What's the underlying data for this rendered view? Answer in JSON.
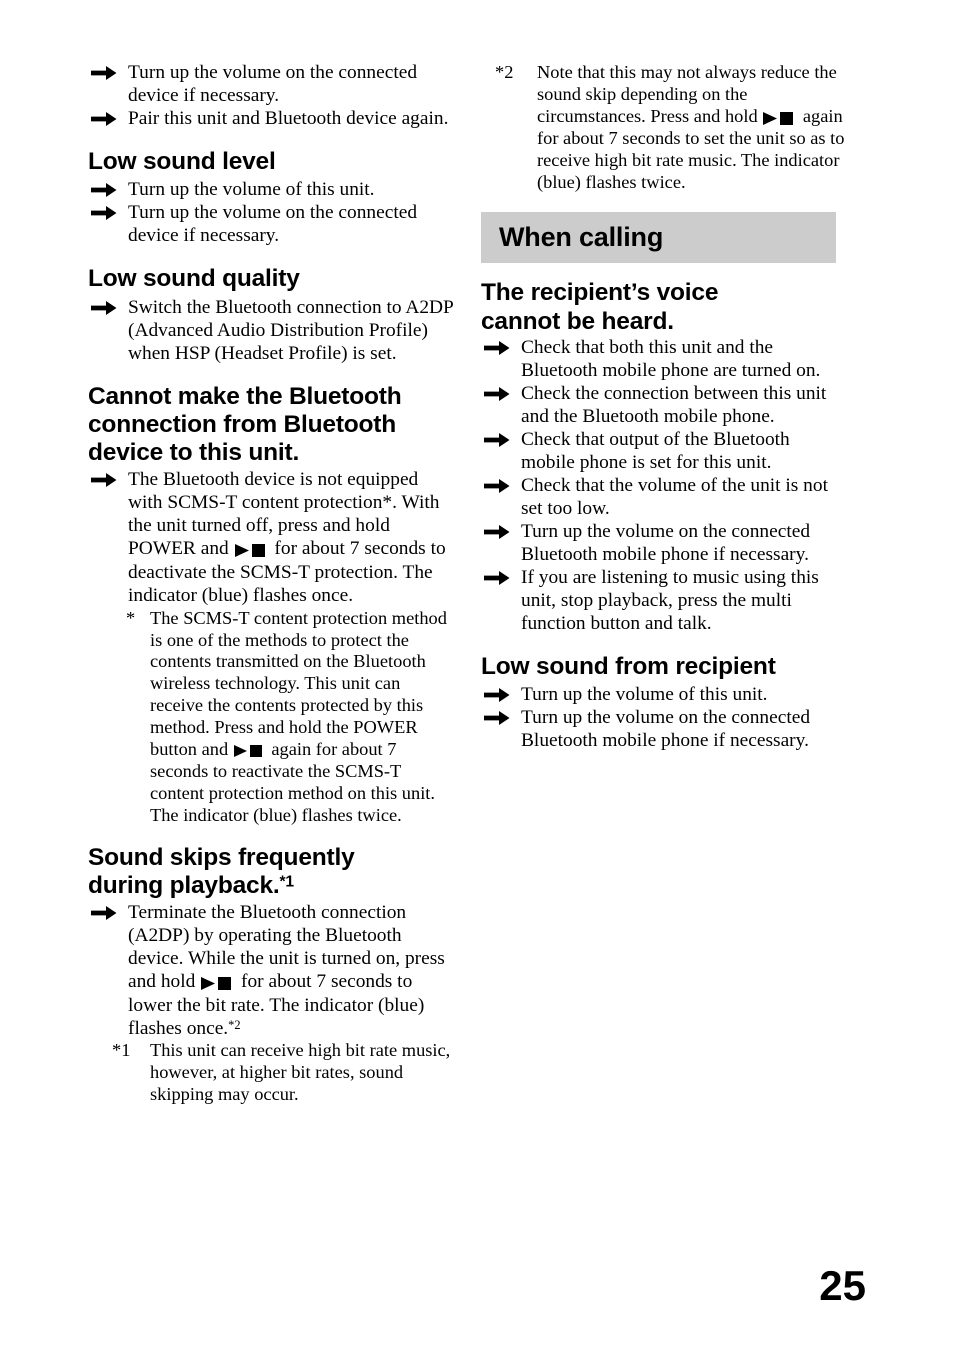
{
  "page": {
    "number": "25",
    "icons": {
      "arrow": "right-arrow-icon",
      "play": "play-icon",
      "stop": "stop-icon"
    },
    "colors": {
      "banner_background": "#cccccc",
      "text": "#000000",
      "page_background": "#ffffff"
    }
  },
  "left_column": {
    "intro_bullets": [
      "Turn up the volume on the connected device if necessary.",
      "Pair this unit and Bluetooth device again."
    ],
    "sections": [
      {
        "heading": "Low sound level",
        "bullets": [
          "Turn up the volume of this unit.",
          "Turn up the volume on the connected device if necessary."
        ]
      },
      {
        "heading": "Low sound quality",
        "bullets": [
          "Switch the Bluetooth connection to A2DP (Advanced Audio Distribution Profile) when HSP (Headset Profile) is set."
        ]
      }
    ],
    "scms_section": {
      "heading": "Cannot make the Bluetooth connection from Bluetooth device to this unit.",
      "bullet_part1": "The Bluetooth device is not equipped with SCMS-T content protection*. With the unit turned off, press and hold POWER and ",
      "bullet_part2": " for about 7 seconds to deactivate the SCMS-T protection. The indicator (blue) flashes once.",
      "subnote_mark": "*",
      "subnote_part1": "The SCMS-T content protection method is one of the methods to protect the contents transmitted on the Bluetooth wireless technology. This unit can receive the contents protected by this method. Press and hold the POWER button and ",
      "subnote_part2": " again for about 7 seconds to reactivate the SCMS-T content protection method on this unit. The indicator (blue) flashes twice."
    },
    "skip_section": {
      "heading_line1": "Sound skips frequently",
      "heading_line2": "during playback.",
      "heading_sup": "*1",
      "bullet_part1": "Terminate the Bluetooth connection (A2DP) by operating the Bluetooth device. While the unit is turned on, press and hold ",
      "bullet_part2": " for about 7 seconds to lower the bit rate. The indicator (blue) flashes once.",
      "bullet_sup": "*2",
      "footnote_mark": "*1",
      "footnote_text": "This unit can receive high bit rate music, however, at higher bit rates, sound skipping may occur."
    }
  },
  "right_column": {
    "footnote": {
      "mark": "*2",
      "part1": "Note that this may not always reduce the sound skip depending on the circumstances. Press and hold ",
      "part2": " again for about 7 seconds to set the unit so as to receive high bit rate music. The indicator (blue) flashes twice."
    },
    "banner_title": "When calling",
    "sections": [
      {
        "heading_line1": "The recipient’s voice",
        "heading_line2": "cannot be heard.",
        "bullets": [
          "Check that both this unit and the Bluetooth mobile phone are turned on.",
          "Check the connection between this unit and the Bluetooth mobile phone.",
          "Check that output of the Bluetooth mobile phone is set for this unit.",
          "Check that the volume of the unit is not set too low.",
          "Turn up the volume on the connected Bluetooth mobile phone if necessary.",
          "If you are listening to music using this unit, stop playback, press the multi function button and talk."
        ]
      },
      {
        "heading": "Low sound from recipient",
        "bullets": [
          "Turn up the volume of this unit.",
          "Turn up the volume on the connected Bluetooth mobile phone if necessary."
        ]
      }
    ]
  }
}
